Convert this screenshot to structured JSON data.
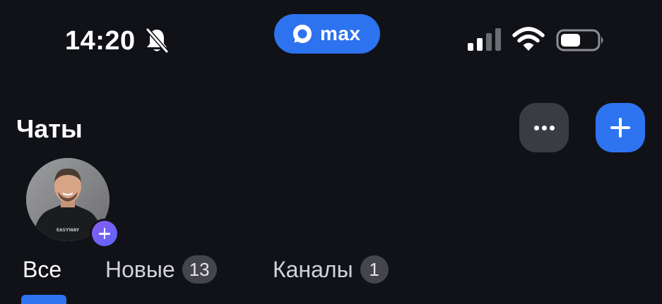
{
  "status_bar": {
    "time": "14:20",
    "mute_icon": "bell-off-icon",
    "carrier_pill_label": "max",
    "carrier_pill_color": "#2d72ee",
    "signal_icon": "cellular-signal-icon",
    "wifi_icon": "wifi-icon",
    "battery_icon": "battery-icon"
  },
  "header": {
    "title": "Чаты",
    "more_icon": "more-dots-icon",
    "add_icon": "plus-icon",
    "accent_color": "#2e74f0"
  },
  "stories": {
    "avatar_shirt_text": "EASYWAY",
    "add_badge_icon": "plus-icon"
  },
  "tabs": [
    {
      "label": "Все",
      "active": true
    },
    {
      "label": "Новые",
      "count": "13"
    },
    {
      "label": "Каналы",
      "count": "1"
    }
  ]
}
